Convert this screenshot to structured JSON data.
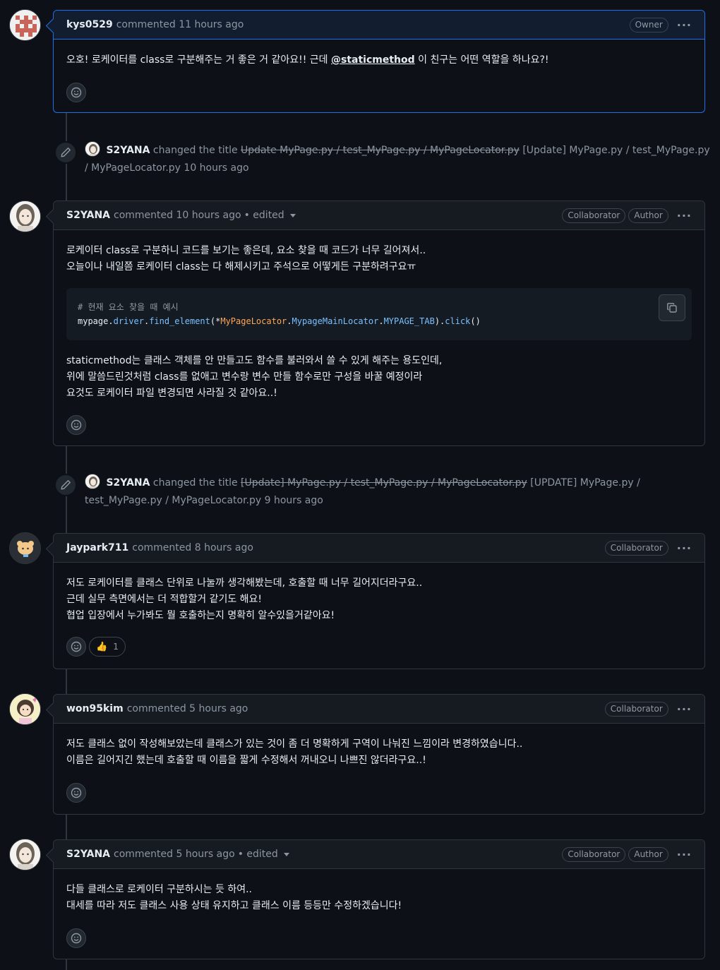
{
  "comments": [
    {
      "author": "kys0529",
      "meta": "commented 11 hours ago",
      "badges": [
        "Owner"
      ],
      "body_parts": {
        "before": "오호! 로케이터를 class로 구분해주는 거 좋은 거 같아요!! 근데 ",
        "mention": "@staticmethod",
        "after": " 이 친구는 어떤 역할을 하나요?!"
      }
    },
    {
      "author": "S2YANA",
      "meta": "commented 10 hours ago",
      "edited": "• edited",
      "badges": [
        "Collaborator",
        "Author"
      ],
      "lines_top": [
        "로케이터 class로 구분하니 코드를 보기는 좋은데, 요소 찾을 때 코드가 너무 길어져서..",
        "오늘이나 내일쯤 로케이터 class는 다 해제시키고 주석으로 어떻게든 구분하려구요ㅠ"
      ],
      "code": {
        "comment": "# 현재 요소 찾을 때 예시",
        "t1": "mypage",
        "t2": ".",
        "t3": "driver",
        "t4": ".",
        "t5": "find_element",
        "t6": "(*",
        "t7": "MyPageLocator",
        "t8": ".",
        "t9": "MypageMainLocator",
        "t10": ".",
        "t11": "MYPAGE_TAB",
        "t12": ").",
        "t13": "click",
        "t14": "()"
      },
      "lines_bottom": [
        "staticmethod는 클래스 객체를 안 만들고도 함수를 불러와서 쓸 수 있게 해주는 용도인데,",
        "위에 말씀드린것처럼 class를 없애고 변수랑 변수 만들 함수로만 구성을 바꿀 예정이라",
        "요것도 로케이터 파일 변경되면 사라질 것 같아요..!"
      ]
    },
    {
      "author": "Jaypark711",
      "meta": "commented 8 hours ago",
      "badges": [
        "Collaborator"
      ],
      "lines": [
        "저도 로케이터를 클래스 단위로 나눌까 생각해봤는데, 호출할 때 너무 길어지더라구요..",
        "근데 실무 측면에서는 더 적합할거 같기도 해요!",
        "협업 입장에서 누가봐도 뭘 호출하는지 명확히 알수있을거같아요!"
      ],
      "reaction": {
        "emoji": "👍",
        "count": "1"
      }
    },
    {
      "author": "won95kim",
      "meta": "commented 5 hours ago",
      "badges": [
        "Collaborator"
      ],
      "lines": [
        "저도 클래스 없이 작성해보았는데 클래스가 있는 것이 좀 더 명확하게 구역이 나눠진 느낌이라 변경하였습니다..",
        "이름은 길어지긴 했는데 호출할 때 이름을 짧게 수정해서 꺼내오니 나쁘진 않더라구요..!"
      ]
    },
    {
      "author": "S2YANA",
      "meta": "commented 5 hours ago",
      "edited": "• edited",
      "badges": [
        "Collaborator",
        "Author"
      ],
      "lines": [
        "다들 클래스로 로케이터 구분하시는 듯 하여..",
        "대세를 따라 저도 클래스 사용 상태 유지하고 클래스 이름 등등만 수정하겠습니다!"
      ]
    }
  ],
  "events": [
    {
      "author": "S2YANA",
      "action": "changed the title",
      "old_title": "Update MyPage.py / test_MyPage.py / MyPageLocator.py",
      "new_title_line1": "[Update] MyPage.py / test_MyPage.py",
      "new_title_line2": "/ MyPageLocator.py",
      "time": "10 hours ago"
    },
    {
      "author": "S2YANA",
      "action": "changed the title",
      "old_title": "[Update] MyPage.py / test_MyPage.py / MyPageLocator.py",
      "new_title_line1": "[UPDATE] MyPage.py /",
      "new_title_line2": "test_MyPage.py / MyPageLocator.py",
      "time": "9 hours ago"
    }
  ],
  "icons": {
    "smile": "smiley-icon",
    "copy": "copy-icon",
    "pencil": "pencil-icon",
    "kebab": "kebab-horizontal-icon"
  },
  "kebab_glyph": "···"
}
